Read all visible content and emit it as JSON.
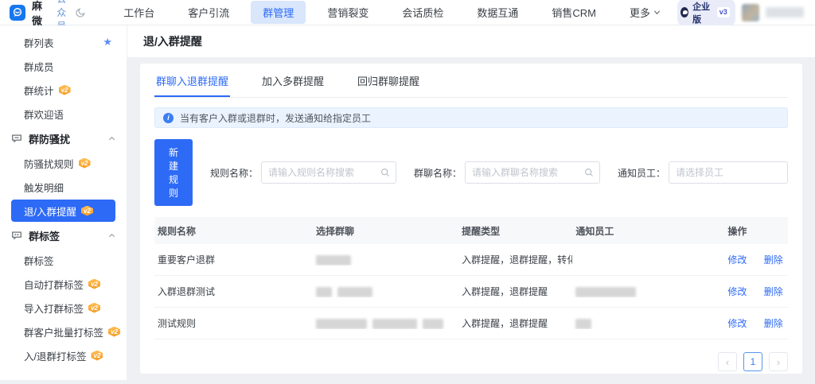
{
  "topbar": {
    "logo_text": "芝麻微客",
    "account_type": "公众号",
    "nav": [
      {
        "label": "工作台"
      },
      {
        "label": "客户引流"
      },
      {
        "label": "群管理"
      },
      {
        "label": "营销裂变"
      },
      {
        "label": "会话质检"
      },
      {
        "label": "数据互通"
      },
      {
        "label": "销售CRM"
      },
      {
        "label": "更多"
      }
    ],
    "edition_label": "企业版",
    "version_label": "v3"
  },
  "sidebar": {
    "badge_label": "v2",
    "items": [
      {
        "label": "群列表"
      },
      {
        "label": "群成员"
      },
      {
        "label": "群统计"
      },
      {
        "label": "群欢迎语"
      },
      {
        "label": "群防骚扰"
      },
      {
        "label": "防骚扰规则"
      },
      {
        "label": "触发明细"
      },
      {
        "label": "退/入群提醒"
      },
      {
        "label": "群标签"
      },
      {
        "label": "群标签"
      },
      {
        "label": "自动打群标签"
      },
      {
        "label": "导入打群标签"
      },
      {
        "label": "群客户批量打标签"
      },
      {
        "label": "入/退群打标签"
      }
    ]
  },
  "page": {
    "title": "退/入群提醒",
    "tabs": [
      {
        "label": "群聊入退群提醒"
      },
      {
        "label": "加入多群提醒"
      },
      {
        "label": "回归群聊提醒"
      }
    ],
    "notice": "当有客户入群或退群时，发送通知给指定员工",
    "toolbar": {
      "new_rule_button": "新建规则",
      "rule_name_label": "规则名称：",
      "rule_name_placeholder": "请输入规则名称搜索",
      "group_name_label": "群聊名称：",
      "group_name_placeholder": "请输入群聊名称搜索",
      "staff_label": "通知员工：",
      "staff_placeholder": "请选择员工"
    },
    "table": {
      "columns": [
        "规则名称",
        "选择群聊",
        "提醒类型",
        "通知员工",
        "操作"
      ],
      "rows": [
        {
          "rule_name": "重要客户退群",
          "remind_type": "入群提醒，退群提醒，转化...",
          "group_chat_redacted": [
            44
          ],
          "staff_redacted": [],
          "edit": "修改",
          "delete": "删除"
        },
        {
          "rule_name": "入群退群测试",
          "remind_type": "入群提醒，退群提醒",
          "group_chat_redacted": [
            20,
            44
          ],
          "staff_redacted": [
            76
          ],
          "edit": "修改",
          "delete": "删除"
        },
        {
          "rule_name": "测试规则",
          "remind_type": "入群提醒，退群提醒",
          "group_chat_redacted": [
            64,
            56,
            26
          ],
          "staff_redacted": [
            20
          ],
          "edit": "修改",
          "delete": "删除"
        }
      ]
    },
    "pagination": {
      "prev": "‹",
      "page": "1",
      "next": "›"
    }
  },
  "colors": {
    "primary": "#2d6af6",
    "nav_active_bg": "#d9e6fc",
    "notice_bg": "#eaf3fe",
    "badge_orange": "#f59a23",
    "table_header_bg": "#f7f8fa"
  }
}
